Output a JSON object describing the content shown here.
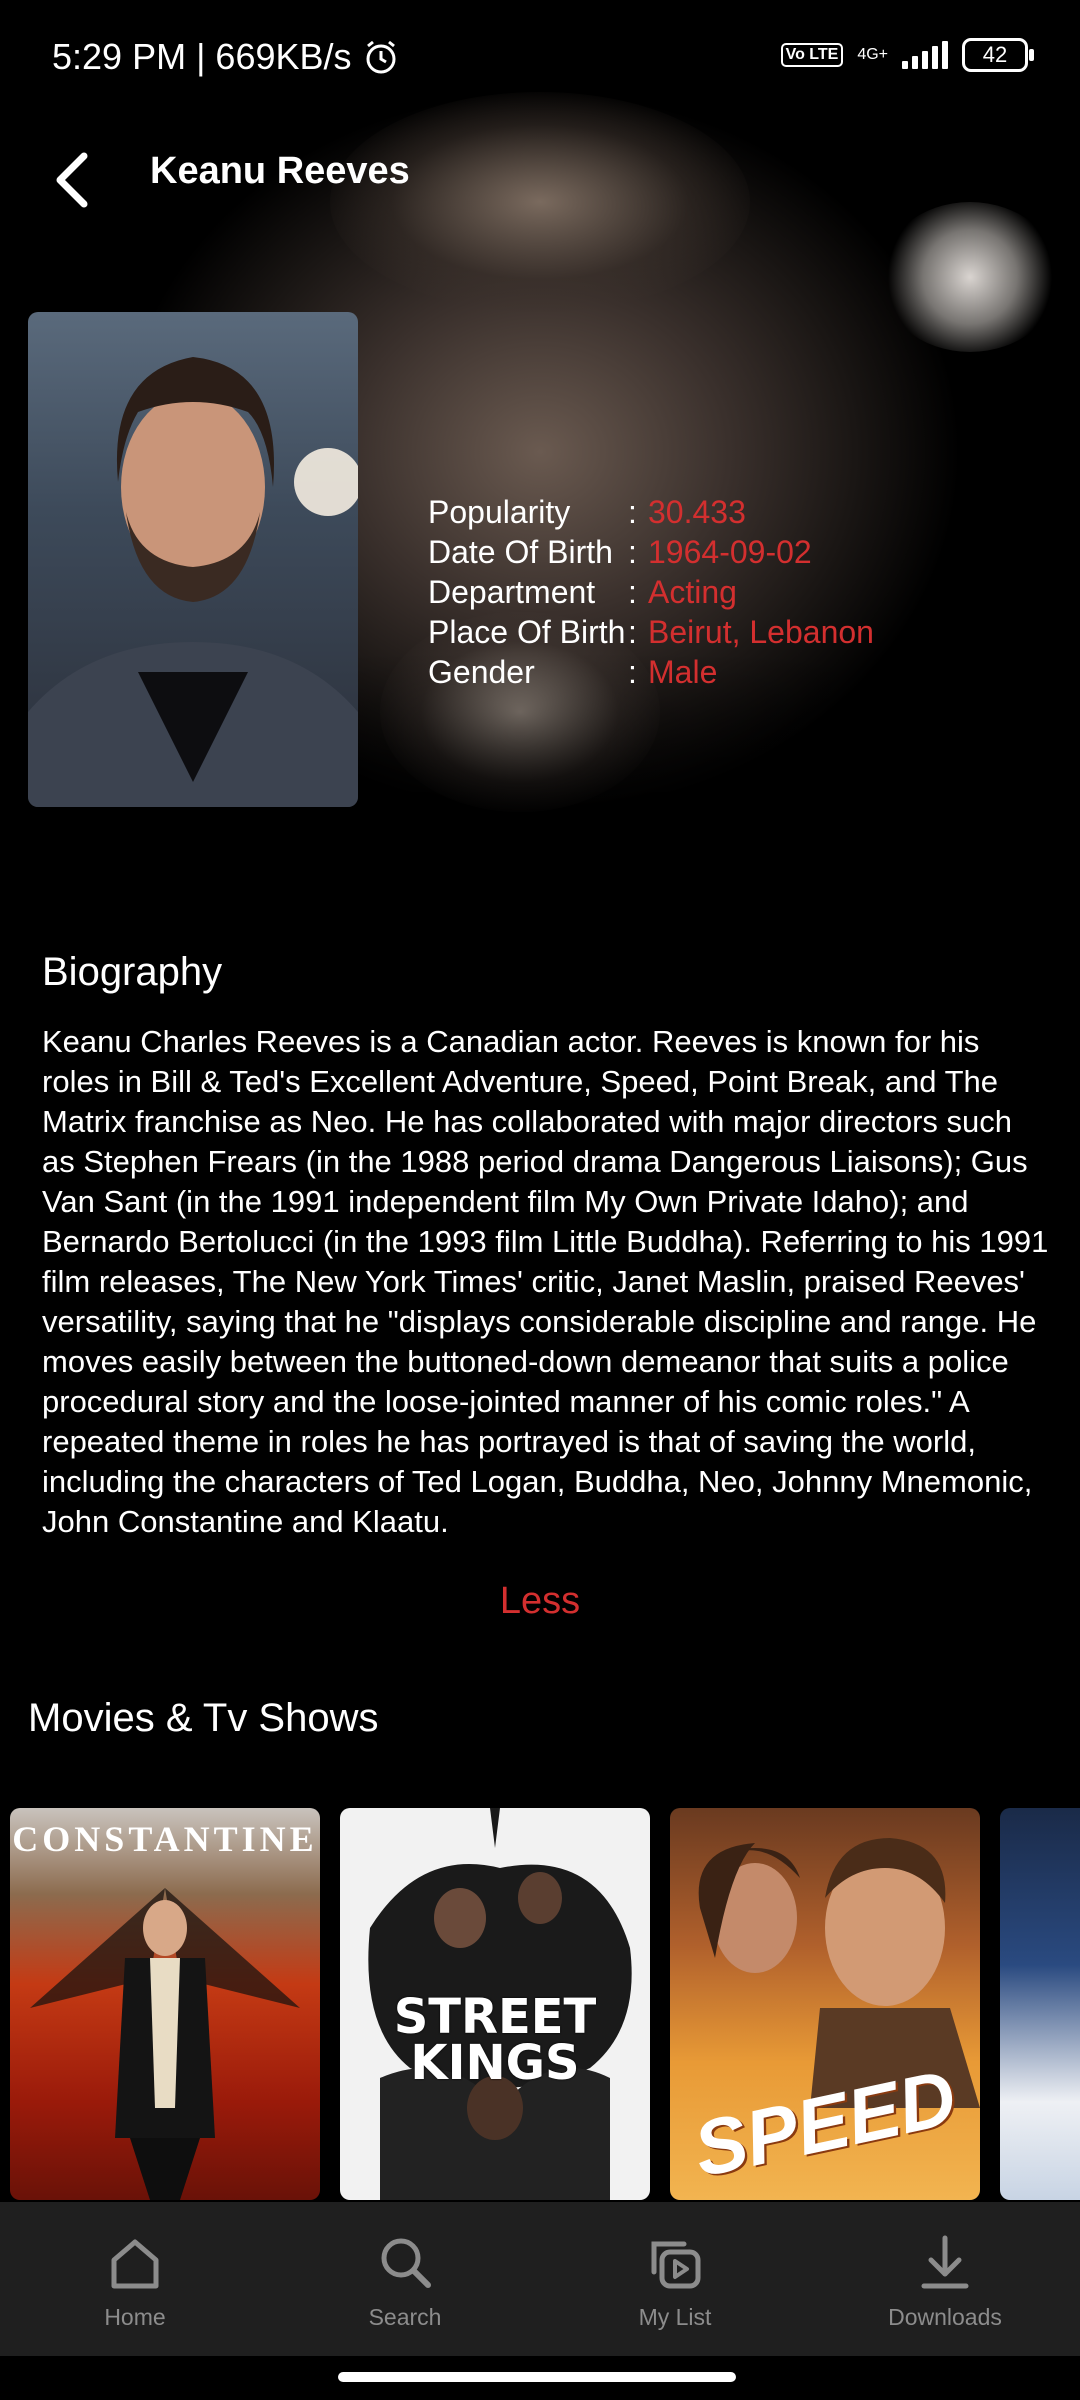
{
  "status_bar": {
    "time_speed": "5:29 PM | 669KB/s",
    "volte": "Vo LTE",
    "network": "4G+",
    "battery": "42"
  },
  "header": {
    "title": "Keanu Reeves"
  },
  "person": {
    "details": [
      {
        "label": "Popularity",
        "value": "30.433"
      },
      {
        "label": "Date Of Birth",
        "value": "1964-09-02"
      },
      {
        "label": "Department",
        "value": "Acting"
      },
      {
        "label": "Place Of Birth",
        "value": "Beirut, Lebanon"
      },
      {
        "label": "Gender",
        "value": "Male"
      }
    ]
  },
  "biography": {
    "heading": "Biography",
    "text": "Keanu Charles Reeves is a Canadian actor. Reeves is known for his roles in Bill & Ted's Excellent Adventure, Speed, Point Break, and The Matrix franchise as Neo. He has collaborated with major directors such as Stephen Frears (in the 1988 period drama Dangerous Liaisons); Gus Van Sant (in the 1991 independent film My Own Private Idaho); and Bernardo Bertolucci (in the 1993 film Little Buddha). Referring to his 1991 film releases, The New York Times' critic, Janet Maslin, praised Reeves' versatility, saying that he \"displays considerable discipline and range. He moves easily between the buttoned-down demeanor that suits a police procedural story and the loose-jointed manner of his comic roles.\" A repeated theme in roles he has portrayed is that of saving the world, including the characters of Ted Logan, Buddha, Neo, Johnny Mnemonic, John Constantine and Klaatu.",
    "toggle_label": "Less"
  },
  "movies": {
    "heading": "Movies & Tv Shows",
    "posters": [
      {
        "title": "CONSTANTINE"
      },
      {
        "title_line1": "STREET",
        "title_line2": "KINGS"
      },
      {
        "title": "SPEED"
      },
      {
        "title": ""
      }
    ]
  },
  "bottom_nav": [
    {
      "label": "Home",
      "icon": "home-icon"
    },
    {
      "label": "Search",
      "icon": "search-icon"
    },
    {
      "label": "My List",
      "icon": "my-list-icon"
    },
    {
      "label": "Downloads",
      "icon": "download-icon"
    }
  ],
  "colors": {
    "accent": "#d32f2f",
    "background": "#000000",
    "nav_background": "#1f1f1f"
  }
}
